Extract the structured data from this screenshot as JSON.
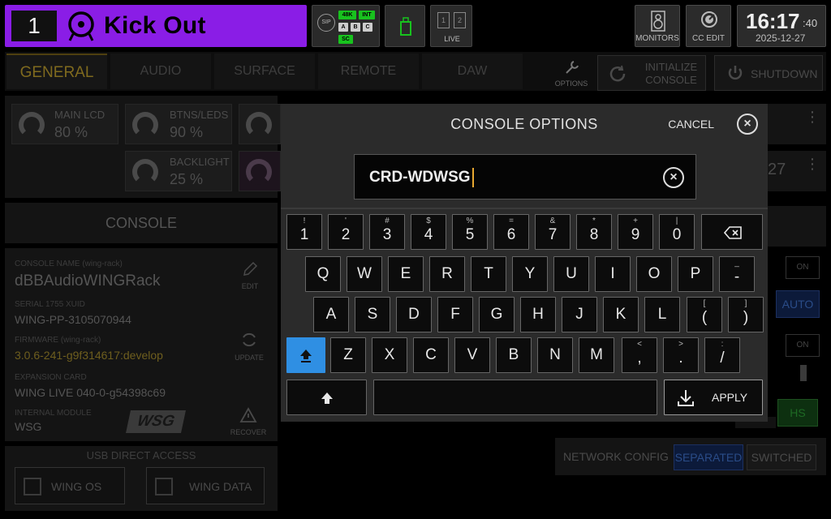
{
  "channel": {
    "number": "1",
    "name": "Kick Out",
    "color": "#8a1de6"
  },
  "status": {
    "sip": "SIP",
    "chips": [
      "48K",
      "INT",
      "A",
      "B",
      "C",
      "SC"
    ],
    "live_label": "LIVE",
    "live_slots": [
      "1",
      "2"
    ]
  },
  "top_buttons": {
    "monitors": "MONITORS",
    "cc_edit": "CC EDIT"
  },
  "clock": {
    "time": "16:17",
    "seconds": ":40",
    "date": "2025-12-27"
  },
  "tabs": [
    {
      "label": "GENERAL",
      "active": true
    },
    {
      "label": "AUDIO"
    },
    {
      "label": "SURFACE"
    },
    {
      "label": "REMOTE"
    },
    {
      "label": "DAW"
    }
  ],
  "header_buttons": {
    "options": "OPTIONS",
    "initialize": [
      "INITIALIZE",
      "CONSOLE"
    ],
    "shutdown": "SHUTDOWN"
  },
  "brightness": [
    {
      "label": "MAIN LCD",
      "value": "80 %"
    },
    {
      "label": "BTNS/LEDS",
      "value": "90 %"
    },
    {
      "label": "BACKLIGHT",
      "value": "25 %"
    }
  ],
  "console": {
    "title": "CONSOLE",
    "name_label": "CONSOLE NAME (wing-rack)",
    "name": "dBBAudioWINGRack",
    "edit": "EDIT",
    "serial_label": "SERIAL 1755 XUID",
    "serial": "WING-PP-3105070944",
    "firmware_label": "FIRMWARE (wing-rack)",
    "firmware": "3.0.6-241-g9f314617:develop",
    "update": "UPDATE",
    "expansion_label": "EXPANSION CARD",
    "expansion": "WING LIVE  040-0-g54398c69",
    "internal_label": "INTERNAL MODULE",
    "internal": "WSG",
    "recover": "RECOVER"
  },
  "usb": {
    "title": "USB DIRECT ACCESS",
    "btn1": "WING OS",
    "btn2": "WING DATA"
  },
  "right_panel": {
    "on1": "ON",
    "auto": "AUTO",
    "on2": "ON",
    "hs": "HS",
    "partial": "27"
  },
  "network": {
    "label": "NETWORK CONFIG",
    "opt1": "SEPARATED",
    "opt2": "SWITCHED"
  },
  "modal": {
    "title": "CONSOLE OPTIONS",
    "cancel": "CANCEL",
    "input_value": "CRD-WDWSG",
    "apply": "APPLY"
  },
  "keyboard": {
    "row1": [
      {
        "top": "!",
        "main": "1"
      },
      {
        "top": "'",
        "main": "2"
      },
      {
        "top": "#",
        "main": "3"
      },
      {
        "top": "$",
        "main": "4"
      },
      {
        "top": "%",
        "main": "5"
      },
      {
        "top": "=",
        "main": "6"
      },
      {
        "top": "&",
        "main": "7"
      },
      {
        "top": "*",
        "main": "8"
      },
      {
        "top": "+",
        "main": "9"
      },
      {
        "top": "|",
        "main": "0"
      }
    ],
    "row2": [
      "Q",
      "W",
      "E",
      "R",
      "T",
      "Y",
      "U",
      "I",
      "O",
      "P"
    ],
    "row2_extra": {
      "top": "_",
      "main": "-"
    },
    "row3": [
      "A",
      "S",
      "D",
      "F",
      "G",
      "H",
      "J",
      "K",
      "L"
    ],
    "row3_extra": [
      {
        "top": "[",
        "main": "("
      },
      {
        "top": "]",
        "main": ")"
      }
    ],
    "row4": [
      "Z",
      "X",
      "C",
      "V",
      "B",
      "N",
      "M"
    ],
    "row4_extra": [
      {
        "top": "<",
        "main": ","
      },
      {
        "top": ">",
        "main": "."
      },
      {
        "top": ":",
        "main": "/"
      }
    ]
  }
}
